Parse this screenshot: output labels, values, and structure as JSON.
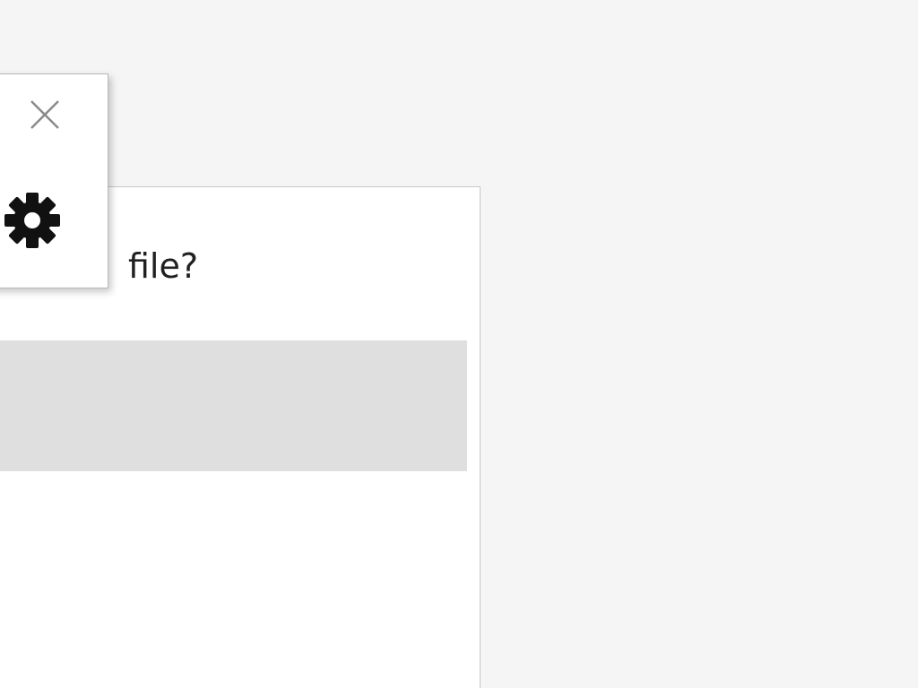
{
  "dialog": {
    "question_text": "file?"
  },
  "float_panel": {
    "close_icon": "close-icon",
    "settings_icon": "gear-icon"
  },
  "colors": {
    "background": "#f5f5f5",
    "panel": "#ffffff",
    "input_area": "#dfdfdf",
    "icon_dark": "#111111",
    "icon_light": "#8a8a8a"
  }
}
